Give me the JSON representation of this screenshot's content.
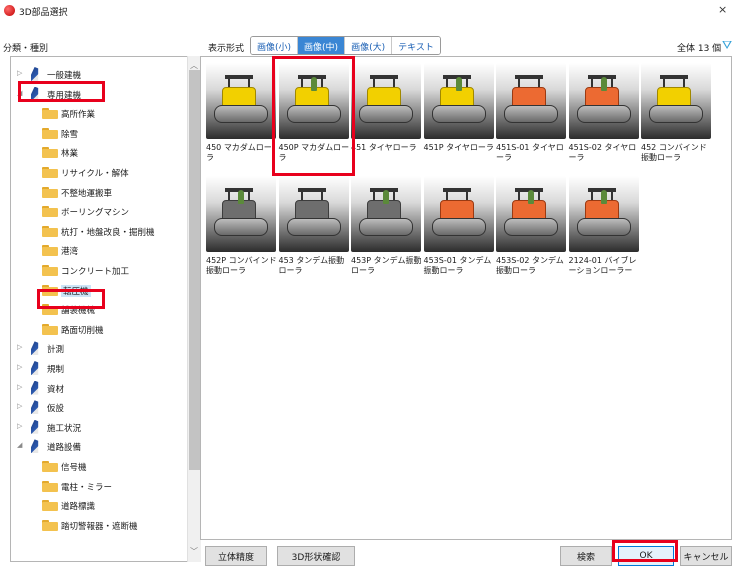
{
  "window": {
    "title": "3D部品選択",
    "close": "×"
  },
  "left_header": "分類・種別",
  "tree": [
    {
      "label": "一般建機",
      "kind": "category",
      "expanded": false
    },
    {
      "label": "専用建機",
      "kind": "category",
      "expanded": true
    },
    {
      "label": "高所作業",
      "kind": "folder"
    },
    {
      "label": "除雪",
      "kind": "folder"
    },
    {
      "label": "林業",
      "kind": "folder"
    },
    {
      "label": "リサイクル・解体",
      "kind": "folder"
    },
    {
      "label": "不整地運搬車",
      "kind": "folder"
    },
    {
      "label": "ボーリングマシン",
      "kind": "folder"
    },
    {
      "label": "杭打・地盤改良・掘削機",
      "kind": "folder"
    },
    {
      "label": "港湾",
      "kind": "folder"
    },
    {
      "label": "コンクリート加工",
      "kind": "folder"
    },
    {
      "label": "転圧機",
      "kind": "folder",
      "selected": true
    },
    {
      "label": "舗装機械",
      "kind": "folder"
    },
    {
      "label": "路面切削機",
      "kind": "folder"
    },
    {
      "label": "計測",
      "kind": "category",
      "expanded": false
    },
    {
      "label": "規制",
      "kind": "category",
      "expanded": false
    },
    {
      "label": "資材",
      "kind": "category",
      "expanded": false
    },
    {
      "label": "仮設",
      "kind": "category",
      "expanded": false
    },
    {
      "label": "施工状況",
      "kind": "category",
      "expanded": false
    },
    {
      "label": "道路設備",
      "kind": "category",
      "expanded": true
    },
    {
      "label": "信号機",
      "kind": "folder"
    },
    {
      "label": "電柱・ミラー",
      "kind": "folder"
    },
    {
      "label": "道路標識",
      "kind": "folder"
    },
    {
      "label": "踏切警報器・遮断機",
      "kind": "folder"
    }
  ],
  "view": {
    "label": "表示形式",
    "tabs": [
      {
        "label": "画像(小)",
        "active": false
      },
      {
        "label": "画像(中)",
        "active": true
      },
      {
        "label": "画像(大)",
        "active": false
      },
      {
        "label": "テキスト",
        "active": false
      }
    ]
  },
  "total": "全体 13 個",
  "items": [
    {
      "label": "450 マカダムローラ",
      "color": "yellow"
    },
    {
      "label": "450P マカダムローラ",
      "color": "yellow"
    },
    {
      "label": "451 タイヤローラ",
      "color": "yellow"
    },
    {
      "label": "451P タイヤローラ",
      "color": "yellow"
    },
    {
      "label": "451S-01 タイヤローラ",
      "color": "orange"
    },
    {
      "label": "451S-02 タイヤローラ",
      "color": "orange"
    },
    {
      "label": "452 コンバインド振動ローラ",
      "color": "yellow"
    },
    {
      "label": "452P コンバインド振動ローラ",
      "color": "gray"
    },
    {
      "label": "453 タンデム振動ローラ",
      "color": "gray"
    },
    {
      "label": "453P タンデム振動ローラ",
      "color": "gray"
    },
    {
      "label": "453S-01 タンデム振動ローラ",
      "color": "orange"
    },
    {
      "label": "453S-02 タンデム振動ローラ",
      "color": "orange"
    },
    {
      "label": "2124-01 バイブレーションローラー",
      "color": "orange"
    }
  ],
  "buttons": {
    "solid_precision": "立体精度",
    "shape_check": "3D形状確認",
    "search": "検索",
    "ok": "OK",
    "cancel": "キャンセル"
  },
  "colors": {
    "highlight": "#e8001c",
    "accent": "#3a86d4"
  }
}
